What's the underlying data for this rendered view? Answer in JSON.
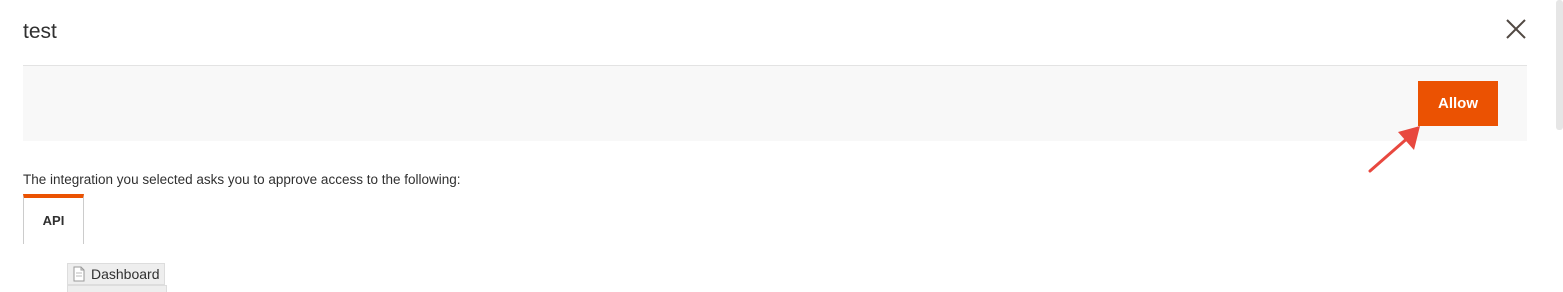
{
  "modal": {
    "title": "test",
    "close_label": "×"
  },
  "actions": {
    "allow_label": "Allow"
  },
  "content": {
    "description": "The integration you selected asks you to approve access to the following:",
    "tabs": [
      {
        "label": "API"
      }
    ],
    "tree": [
      {
        "label": "Dashboard",
        "icon": "document-icon"
      }
    ]
  },
  "colors": {
    "accent": "#eb5202",
    "annotation_arrow": "#e8483f",
    "action_bar_bg": "#f8f8f8"
  }
}
